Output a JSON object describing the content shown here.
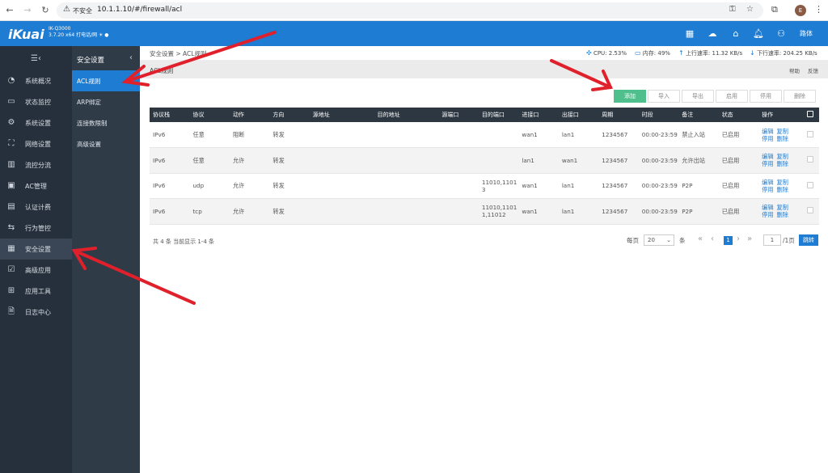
{
  "browser": {
    "insecure_label": "不安全",
    "url": "10.1.1.10/#/firewall/acl",
    "profile_initial": "E"
  },
  "topbar": {
    "logo": "iKuai",
    "model_line1": "IK-Q3000",
    "model_line2": "3.7.20 x64 打电话/网 ☀ ●",
    "user": "路体"
  },
  "sidebar": {
    "items": [
      {
        "label": "系统概况",
        "icon": "dashboard-icon"
      },
      {
        "label": "状态监控",
        "icon": "monitor-icon"
      },
      {
        "label": "系统设置",
        "icon": "gear-icon"
      },
      {
        "label": "网络设置",
        "icon": "network-icon"
      },
      {
        "label": "流控分流",
        "icon": "flow-icon"
      },
      {
        "label": "AC管理",
        "icon": "ac-icon"
      },
      {
        "label": "认证计费",
        "icon": "auth-icon"
      },
      {
        "label": "行为管控",
        "icon": "arrows-icon"
      },
      {
        "label": "安全设置",
        "icon": "security-icon"
      },
      {
        "label": "高级应用",
        "icon": "advanced-icon"
      },
      {
        "label": "应用工具",
        "icon": "tools-icon"
      },
      {
        "label": "日志中心",
        "icon": "log-icon"
      }
    ]
  },
  "subnav": {
    "title": "安全设置",
    "items": [
      "ACL规则",
      "ARP绑定",
      "连接数限制",
      "高级设置"
    ]
  },
  "breadcrumb": "安全设置 > ACL规则",
  "stats": {
    "cpu": "CPU: 2.53%",
    "mem": "内存: 49%",
    "up": "上行速率: 11.32 KB/s",
    "down": "下行速率: 204.25 KB/s"
  },
  "page_title": "ACL规则",
  "help_links": {
    "help": "帮助",
    "feedback": "反馈"
  },
  "toolbar": {
    "add": "添加",
    "import": "导入",
    "export": "导出",
    "enable": "启用",
    "disable": "停用",
    "delete": "删除"
  },
  "table": {
    "headers": [
      "协议栈",
      "协议",
      "动作",
      "方向",
      "源地址",
      "目的地址",
      "源端口",
      "目的端口",
      "进接口",
      "出接口",
      "周期",
      "时段",
      "备注",
      "状态",
      "操作"
    ],
    "rows": [
      [
        "IPv6",
        "任意",
        "阻断",
        "转发",
        "",
        "",
        "",
        "",
        "wan1",
        "lan1",
        "1234567",
        "00:00-23:59",
        "禁止入站",
        "已启用"
      ],
      [
        "IPv6",
        "任意",
        "允许",
        "转发",
        "",
        "",
        "",
        "",
        "lan1",
        "wan1",
        "1234567",
        "00:00-23:59",
        "允许出站",
        "已启用"
      ],
      [
        "IPv6",
        "udp",
        "允许",
        "转发",
        "",
        "",
        "",
        "11010,11013",
        "wan1",
        "lan1",
        "1234567",
        "00:00-23:59",
        "P2P",
        "已启用"
      ],
      [
        "IPv6",
        "tcp",
        "允许",
        "转发",
        "",
        "",
        "",
        "11010,11011,11012",
        "wan1",
        "lan1",
        "1234567",
        "00:00-23:59",
        "P2P",
        "已启用"
      ]
    ],
    "actions": {
      "edit": "编辑",
      "copy": "复制",
      "disable": "停用",
      "delete": "删除"
    }
  },
  "pagination": {
    "summary": "共 4 条 当前显示 1-4 条",
    "per_page_label": "每页",
    "per_page": "20",
    "unit": "条",
    "current_page": "1",
    "page_input": "1",
    "total_pages": "/1页",
    "go": "跳转"
  },
  "colors": {
    "topbar": "#1e7cd2",
    "sidebar": "#26303c",
    "subnav": "#303b48",
    "primary_button": "#4fc08d",
    "annotation_arrow": "#e0202a"
  }
}
